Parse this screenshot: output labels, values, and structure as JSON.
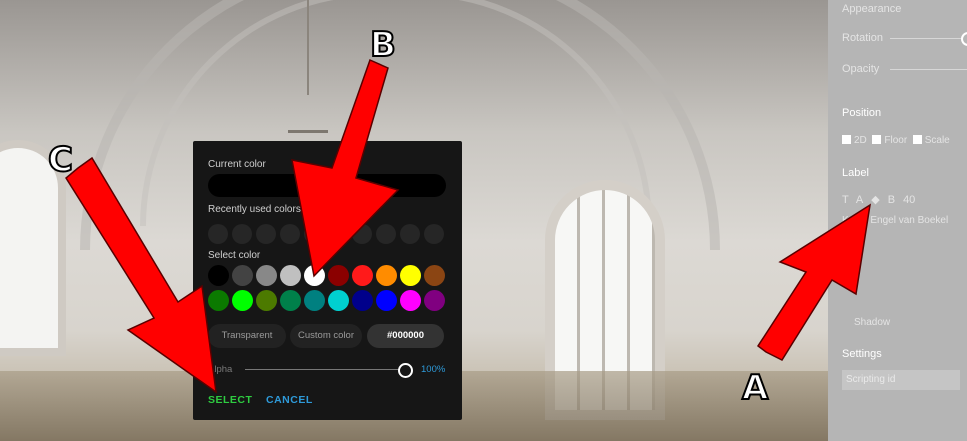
{
  "panel": {
    "appearance_title": "Appearance",
    "rotation_label": "Rotation",
    "opacity_label": "Opacity",
    "position_title": "Position",
    "pos_2d": "2D",
    "pos_floor": "Floor",
    "pos_scale": "Scale",
    "label_title": "Label",
    "label_toolbar": [
      "T",
      "A",
      "◆",
      "B",
      "40"
    ],
    "label_text": "Kapel Engel van Boekel",
    "shadow_label": "Shadow",
    "settings_title": "Settings",
    "scripting_placeholder": "Scripting id"
  },
  "dialog": {
    "current_color_label": "Current color",
    "recent_label": "Recently used colors",
    "select_label": "Select color",
    "transparent_label": "Transparent",
    "custom_label": "Custom color",
    "hex_value": "#000000",
    "alpha_label": "Alpha",
    "alpha_value": "100%",
    "select_button": "SELECT",
    "cancel_button": "CANCEL",
    "swatches_row1": [
      "#000000",
      "#434343",
      "#888888",
      "#c0c0c0",
      "#ffffff",
      "#8b0000",
      "#ff1a1a",
      "#ff8c00",
      "#ffff00",
      "#8b4513"
    ],
    "swatches_row2": [
      "#0b7a00",
      "#00ff00",
      "#4c7a00",
      "#00804a",
      "#008080",
      "#00d0d0",
      "#00008b",
      "#0000ff",
      "#ff00ff",
      "#800080"
    ]
  },
  "annotations": {
    "a": "A",
    "b": "B",
    "c": "C"
  },
  "colors": {
    "arrow": "#ff0000",
    "select_green": "#2ecc40",
    "cancel_blue": "#2e9ad9"
  }
}
